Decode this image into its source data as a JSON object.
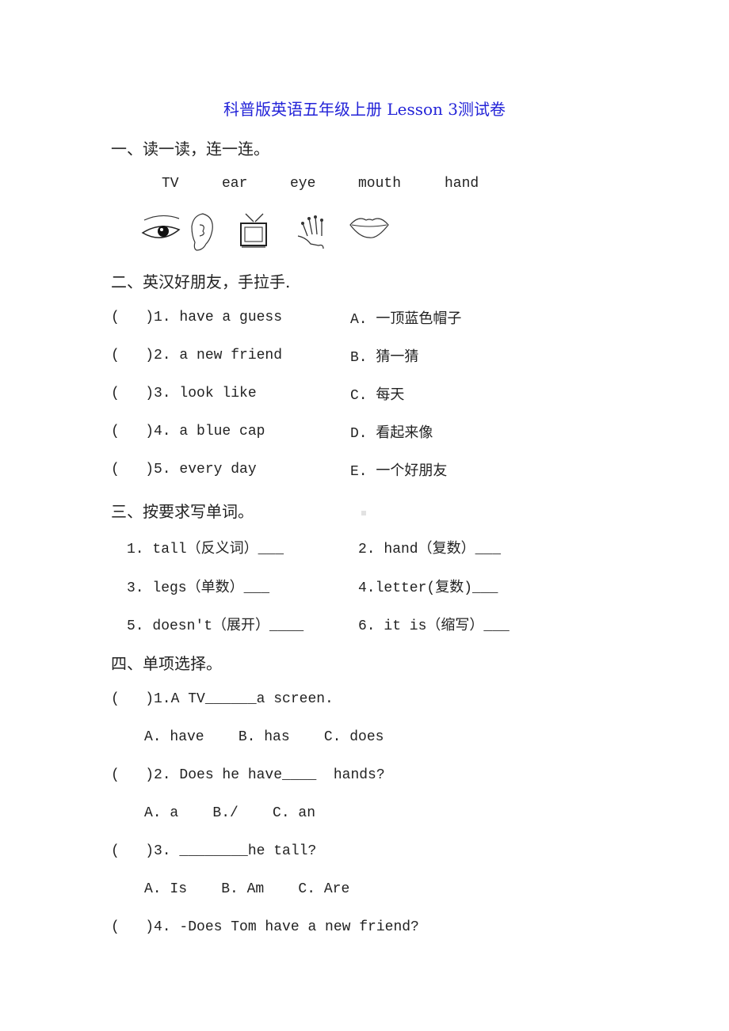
{
  "title": "科普版英语五年级上册 Lesson 3测试卷",
  "section1": {
    "heading": "一、读一读，连一连。",
    "words": [
      "TV",
      "ear",
      "eye",
      "mouth",
      "hand"
    ],
    "pictures": [
      "eye",
      "ear",
      "tv",
      "hand",
      "mouth"
    ]
  },
  "section2": {
    "heading": "二、英汉好朋友，手拉手.",
    "items": [
      {
        "left": "(   )1. have a guess",
        "right": "A. 一顶蓝色帽子"
      },
      {
        "left": "(   )2. a new friend",
        "right": "B. 猜一猜"
      },
      {
        "left": "(   )3. look like",
        "right": "C. 每天"
      },
      {
        "left": "(   )4. a blue cap",
        "right": "D. 看起来像"
      },
      {
        "left": "(   )5. every day",
        "right": "E. 一个好朋友"
      }
    ]
  },
  "section3": {
    "heading": "三、按要求写单词。",
    "items": [
      "1. tall（反义词）___",
      "2. hand（复数）___",
      "3. legs（单数）___",
      "4.letter(复数)___",
      "5. doesn't（展开）____",
      "6. it is（缩写）___"
    ]
  },
  "section4": {
    "heading": "四、单项选择。",
    "questions": [
      {
        "q": "(   )1.A TV______a screen.",
        "options": "A. have    B. has    C. does"
      },
      {
        "q": "(   )2. Does he have____  hands?",
        "options": "A. a    B./    C. an"
      },
      {
        "q": "(   )3. ________he tall?",
        "options": "A. Is    B. Am    C. Are"
      },
      {
        "q": "(   )4. -Does Tom have a new friend?"
      }
    ]
  }
}
